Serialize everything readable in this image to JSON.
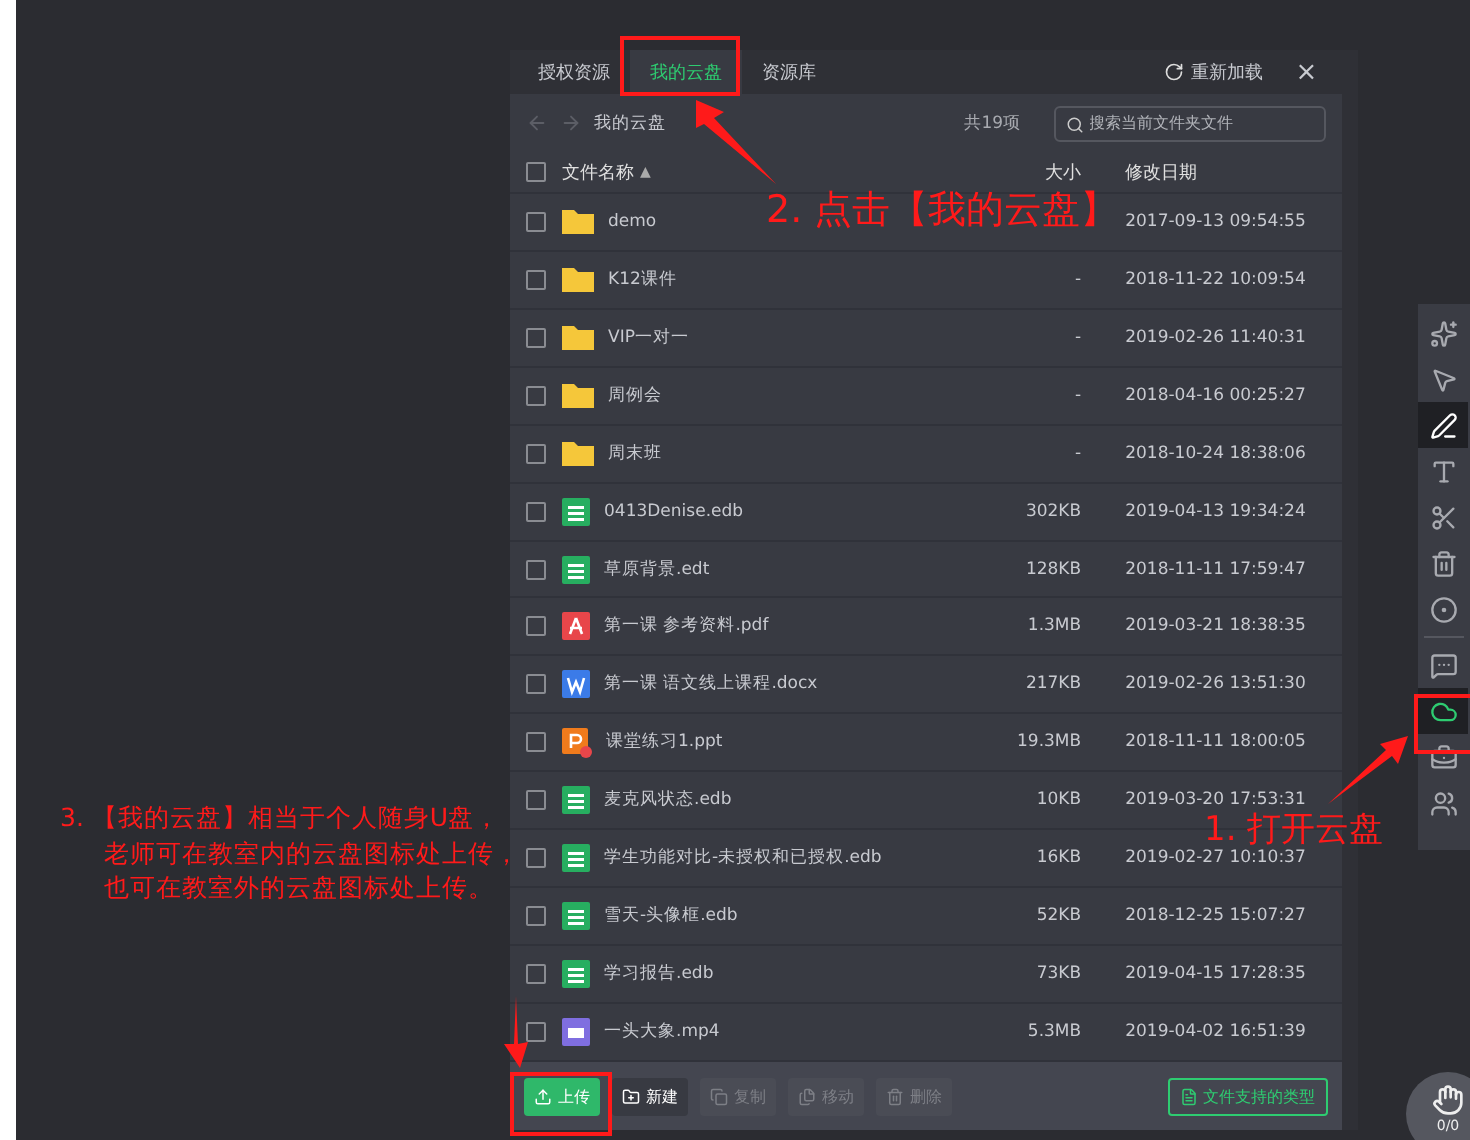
{
  "tabs": [
    {
      "label": "授权资源",
      "selected": false
    },
    {
      "label": "我的云盘",
      "selected": true
    },
    {
      "label": "资源库",
      "selected": false
    }
  ],
  "reload": "重新加载",
  "close": "×",
  "breadcrumb": "我的云盘",
  "count": "共19项",
  "search": {
    "placeholder": "搜索当前文件夹文件"
  },
  "header": {
    "checked": false,
    "name": "文件名称",
    "sort_indicator": "▲",
    "size": "大小",
    "date": "修改日期"
  },
  "rows": [
    {
      "kind": "folder",
      "name": "demo",
      "size": "",
      "date": "2017-09-13 09:54:55",
      "checked": false
    },
    {
      "kind": "folder",
      "name": "K12课件",
      "size": "-",
      "date": "2018-11-22 10:09:54",
      "checked": false
    },
    {
      "kind": "folder",
      "name": "VIP一对一",
      "size": "-",
      "date": "2019-02-26 11:40:31",
      "checked": false
    },
    {
      "kind": "folder",
      "name": "周例会",
      "size": "-",
      "date": "2018-04-16 00:25:27",
      "checked": false
    },
    {
      "kind": "folder",
      "name": "周末班",
      "size": "-",
      "date": "2018-10-24 18:38:06",
      "checked": false
    },
    {
      "kind": "edb",
      "name": "0413Denise.edb",
      "size": "302KB",
      "date": "2019-04-13 19:34:24",
      "checked": false
    },
    {
      "kind": "edb",
      "name": "草原背景.edt",
      "size": "128KB",
      "date": "2018-11-11 17:59:47",
      "checked": false
    },
    {
      "kind": "pdf",
      "name": "第一课 参考资料.pdf",
      "size": "1.3MB",
      "date": "2019-03-21 18:38:35",
      "checked": false
    },
    {
      "kind": "doc",
      "name": "第一课 语文线上课程.docx",
      "size": "217KB",
      "date": "2019-02-26 13:51:30",
      "checked": false
    },
    {
      "kind": "ppt",
      "name": "课堂练习1.ppt",
      "size": "19.3MB",
      "date": "2018-11-11 18:00:05",
      "checked": false
    },
    {
      "kind": "edb",
      "name": "麦克风状态.edb",
      "size": "10KB",
      "date": "2019-03-20 17:53:31",
      "checked": false
    },
    {
      "kind": "edb",
      "name": "学生功能对比-未授权和已授权.edb",
      "size": "16KB",
      "date": "2019-02-27 10:10:37",
      "checked": false
    },
    {
      "kind": "edb",
      "name": "雪天-头像框.edb",
      "size": "52KB",
      "date": "2018-12-25 15:07:27",
      "checked": false
    },
    {
      "kind": "edb",
      "name": "学习报告.edb",
      "size": "73KB",
      "date": "2019-04-15 17:28:35",
      "checked": false
    },
    {
      "kind": "video",
      "name": "一头大象.mp4",
      "size": "5.3MB",
      "date": "2019-04-02 16:51:39",
      "checked": false
    }
  ],
  "footer_buttons": [
    {
      "kind": "upload",
      "label": "上传",
      "disabled": false
    },
    {
      "kind": "new",
      "label": "新建",
      "disabled": false
    },
    {
      "kind": "copy",
      "label": "复制",
      "disabled": true
    },
    {
      "kind": "move",
      "label": "移动",
      "disabled": true
    },
    {
      "kind": "delete",
      "label": "删除",
      "disabled": true
    }
  ],
  "types_link": "文件支持的类型",
  "tools": [
    {
      "kind": "laser",
      "selected": false
    },
    {
      "kind": "select",
      "selected": false
    },
    {
      "kind": "pen",
      "selected": true
    },
    {
      "kind": "text",
      "selected": false
    },
    {
      "kind": "scissors",
      "selected": false
    },
    {
      "kind": "trash",
      "selected": false
    },
    {
      "kind": "shapes",
      "selected": false
    },
    {
      "kind": "divider"
    },
    {
      "kind": "chat",
      "selected": false
    },
    {
      "kind": "cloud",
      "selected": true
    },
    {
      "kind": "toolbox",
      "selected": false
    },
    {
      "kind": "users",
      "selected": false
    }
  ],
  "hand_count": "0/0",
  "annotations": [
    {
      "kind": "tab",
      "lines": [
        "2. 点击【我的云盘】"
      ]
    },
    {
      "kind": "cloud",
      "lines": [
        "1. 打开云盘"
      ]
    },
    {
      "kind": "upload",
      "lines": [
        "3. 【我的云盘】相当于个人随身U盘，",
        "老师可在教室内的云盘图标处上传，",
        "也可在教室外的云盘图标处上传。"
      ]
    }
  ]
}
